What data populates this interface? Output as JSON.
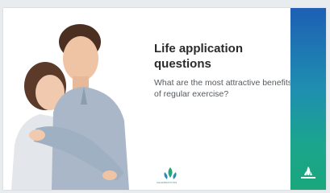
{
  "slide": {
    "title": "Life application questions",
    "question": "What are the most attractive benefits of regular exercise?",
    "logo_text": "CELEBRATIONS"
  },
  "colors": {
    "band_top": "#1d5fb4",
    "band_bottom": "#1aa77b",
    "title": "#2b2b2b",
    "body": "#555b60"
  },
  "icons": {
    "photo": "couple-embracing-photo",
    "logo": "celebrations-logo",
    "band": "adventist-flame-icon"
  }
}
